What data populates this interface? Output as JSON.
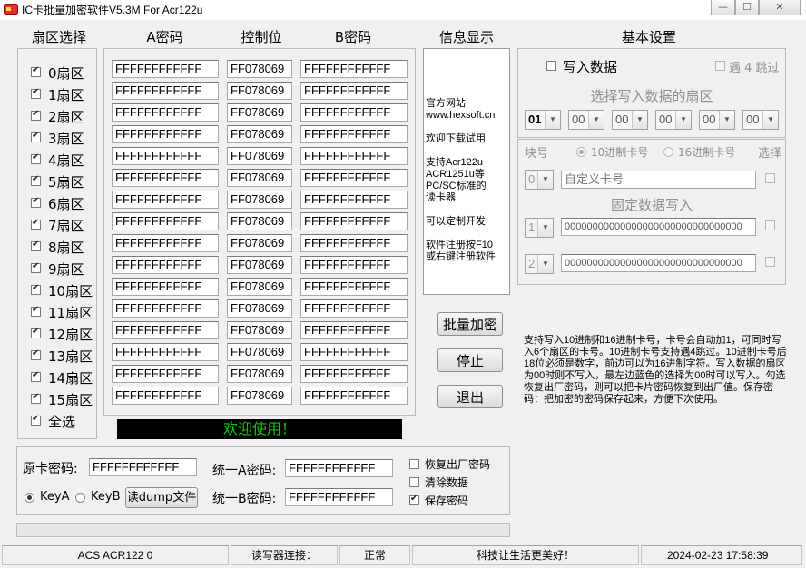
{
  "window": {
    "title": "IC卡批量加密软件V5.3M For Acr122u",
    "minimize": "—",
    "maximize": "☐",
    "close": "✕"
  },
  "headers": {
    "sectors": "扇区选择",
    "key_a": "A密码",
    "control": "控制位",
    "key_b": "B密码",
    "info": "信息显示",
    "basic": "基本设置"
  },
  "sectors": [
    {
      "label": "0扇区",
      "checked": true,
      "key_a": "FFFFFFFFFFFF",
      "control": "FF078069",
      "key_b": "FFFFFFFFFFFF"
    },
    {
      "label": "1扇区",
      "checked": true,
      "key_a": "FFFFFFFFFFFF",
      "control": "FF078069",
      "key_b": "FFFFFFFFFFFF"
    },
    {
      "label": "2扇区",
      "checked": true,
      "key_a": "FFFFFFFFFFFF",
      "control": "FF078069",
      "key_b": "FFFFFFFFFFFF"
    },
    {
      "label": "3扇区",
      "checked": true,
      "key_a": "FFFFFFFFFFFF",
      "control": "FF078069",
      "key_b": "FFFFFFFFFFFF"
    },
    {
      "label": "4扇区",
      "checked": true,
      "key_a": "FFFFFFFFFFFF",
      "control": "FF078069",
      "key_b": "FFFFFFFFFFFF"
    },
    {
      "label": "5扇区",
      "checked": true,
      "key_a": "FFFFFFFFFFFF",
      "control": "FF078069",
      "key_b": "FFFFFFFFFFFF"
    },
    {
      "label": "6扇区",
      "checked": true,
      "key_a": "FFFFFFFFFFFF",
      "control": "FF078069",
      "key_b": "FFFFFFFFFFFF"
    },
    {
      "label": "7扇区",
      "checked": true,
      "key_a": "FFFFFFFFFFFF",
      "control": "FF078069",
      "key_b": "FFFFFFFFFFFF"
    },
    {
      "label": "8扇区",
      "checked": true,
      "key_a": "FFFFFFFFFFFF",
      "control": "FF078069",
      "key_b": "FFFFFFFFFFFF"
    },
    {
      "label": "9扇区",
      "checked": true,
      "key_a": "FFFFFFFFFFFF",
      "control": "FF078069",
      "key_b": "FFFFFFFFFFFF"
    },
    {
      "label": "10扇区",
      "checked": true,
      "key_a": "FFFFFFFFFFFF",
      "control": "FF078069",
      "key_b": "FFFFFFFFFFFF"
    },
    {
      "label": "11扇区",
      "checked": true,
      "key_a": "FFFFFFFFFFFF",
      "control": "FF078069",
      "key_b": "FFFFFFFFFFFF"
    },
    {
      "label": "12扇区",
      "checked": true,
      "key_a": "FFFFFFFFFFFF",
      "control": "FF078069",
      "key_b": "FFFFFFFFFFFF"
    },
    {
      "label": "13扇区",
      "checked": true,
      "key_a": "FFFFFFFFFFFF",
      "control": "FF078069",
      "key_b": "FFFFFFFFFFFF"
    },
    {
      "label": "14扇区",
      "checked": true,
      "key_a": "FFFFFFFFFFFF",
      "control": "FF078069",
      "key_b": "FFFFFFFFFFFF"
    },
    {
      "label": "15扇区",
      "checked": true,
      "key_a": "FFFFFFFFFFFF",
      "control": "FF078069",
      "key_b": "FFFFFFFFFFFF"
    }
  ],
  "select_all": {
    "label": "全选",
    "checked": true
  },
  "welcome_banner": "欢迎使用！",
  "info_lines": [
    "官方网站",
    "www.hexsoft.cn",
    "",
    "欢迎下载试用",
    "",
    "支持Acr122u",
    "ACR1251u等",
    "PC/SC标准的",
    "读卡器",
    "",
    "可以定制开发",
    "",
    "软件注册按F10",
    "或右键注册软件"
  ],
  "actions": {
    "batch_encrypt": "批量加密",
    "stop": "停止",
    "exit": "退出"
  },
  "basic": {
    "write_data_label": "写入数据",
    "skip4_label": "遇 4 跳过",
    "select_sectors_label": "选择写入数据的扇区",
    "sector_combos": [
      "01",
      "00",
      "00",
      "00",
      "00",
      "00"
    ],
    "block_label": "块号",
    "radio_dec": "10进制卡号",
    "radio_hex": "16进制卡号",
    "select_label": "选择",
    "block_combo": "0",
    "custom_card_no": "自定义卡号",
    "fixed_data_label": "固定数据写入",
    "fixed_rows": [
      {
        "block": "1",
        "value": "00000000000000000000000000000000"
      },
      {
        "block": "2",
        "value": "00000000000000000000000000000000"
      }
    ]
  },
  "help_text": "支持写入10进制和16进制卡号，卡号会自动加1，可同时写入6个扇区的卡号。10进制卡号支持遇4跳过。10进制卡号后18位必须是数字，前边可以为16进制字符。写入数据的扇区为00时则不写入，最左边蓝色的选择为00时可以写入。勾选恢复出厂密码，则可以把卡片密码恢复到出厂值。保存密码：把加密的密码保存起来，方便下次使用。",
  "bottom": {
    "orig_key_label": "原卡密码:",
    "orig_key_value": "FFFFFFFFFFFF",
    "keya_label": "KeyA",
    "keyb_label": "KeyB",
    "read_dump_button": "读dump文件",
    "unify_a_label": "统一A密码:",
    "unify_a_value": "FFFFFFFFFFFF",
    "unify_b_label": "统一B密码:",
    "unify_b_value": "FFFFFFFFFFFF",
    "restore_factory": "恢复出厂密码",
    "clear_data": "清除数据",
    "save_password": "保存密码"
  },
  "status": {
    "reader": "ACS ACR122 0",
    "conn_label": "读写器连接：",
    "conn_state": "正常",
    "slogan": "科技让生活更美好！",
    "datetime": "2024-02-23 17:58:39"
  },
  "colors": {
    "banner_bg": "#000000",
    "banner_fg": "#00cc00",
    "window_bg": "#f0f0f0",
    "selected_combo": "#0a64c8"
  },
  "icons": {
    "app": "ic-card-icon"
  }
}
